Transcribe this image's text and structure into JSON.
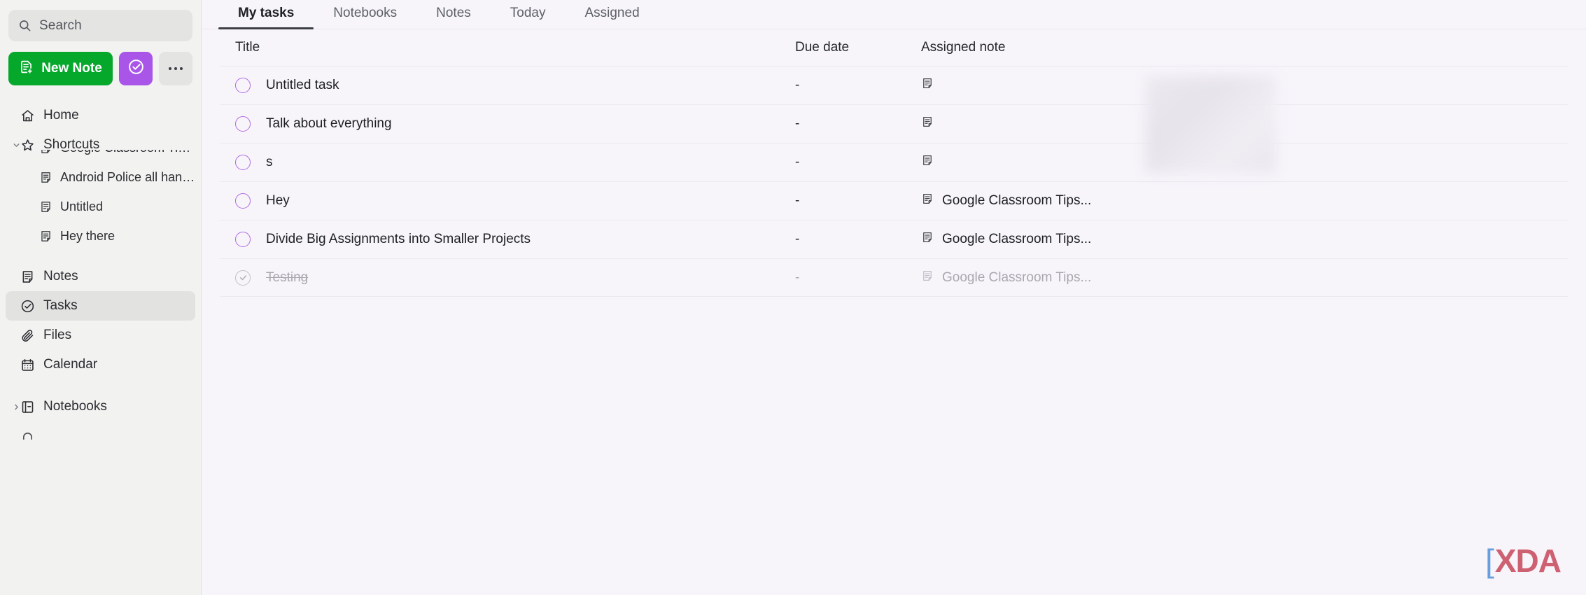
{
  "sidebar": {
    "search": {
      "placeholder": "Search",
      "icon": "search-icon"
    },
    "new_note_button": {
      "label": "New Note",
      "icon": "note-plus-icon",
      "color": "#06a82c"
    },
    "task_button": {
      "icon": "check-circle-icon",
      "color": "#a855e8"
    },
    "more_button": {
      "icon": "ellipsis-icon",
      "color": "#e4e4e3"
    },
    "nav": [
      {
        "label": "Home",
        "icon": "home-icon",
        "selected": false
      },
      {
        "label": "Shortcuts",
        "icon": "star-icon",
        "selected": false,
        "expanded": true
      }
    ],
    "shortcuts": [
      {
        "label": "Google Classroom Tips...",
        "icon": "note-icon"
      },
      {
        "label": "Android Police all hand...",
        "icon": "note-icon"
      },
      {
        "label": "Untitled",
        "icon": "note-icon"
      },
      {
        "label": "Hey there",
        "icon": "note-icon"
      }
    ],
    "sections": [
      {
        "label": "Notes",
        "icon": "note-icon",
        "selected": false
      },
      {
        "label": "Tasks",
        "icon": "check-circle-icon",
        "selected": true
      },
      {
        "label": "Files",
        "icon": "paperclip-icon",
        "selected": false
      },
      {
        "label": "Calendar",
        "icon": "calendar-icon",
        "selected": false
      }
    ],
    "notebooks": {
      "label": "Notebooks",
      "icon": "notebook-icon",
      "expanded": false
    }
  },
  "main": {
    "tabs": [
      {
        "label": "My tasks",
        "active": true
      },
      {
        "label": "Notebooks",
        "active": false
      },
      {
        "label": "Notes",
        "active": false
      },
      {
        "label": "Today",
        "active": false
      },
      {
        "label": "Assigned",
        "active": false
      }
    ],
    "columns": {
      "title": "Title",
      "due_date": "Due date",
      "assigned_note": "Assigned note"
    },
    "tasks": [
      {
        "title": "Untitled task",
        "due": "-",
        "note": "",
        "note_icon": "note-icon",
        "completed": false
      },
      {
        "title": "Talk about everything",
        "due": "-",
        "note": "",
        "note_icon": "note-icon",
        "completed": false
      },
      {
        "title": "s",
        "due": "-",
        "note": "",
        "note_icon": "note-icon",
        "completed": false
      },
      {
        "title": "Hey",
        "due": "-",
        "note": "Google Classroom Tips...",
        "note_icon": "note-icon",
        "completed": false
      },
      {
        "title": "Divide Big Assignments into Smaller Projects",
        "due": "-",
        "note": "Google Classroom Tips...",
        "note_icon": "note-icon",
        "completed": false
      },
      {
        "title": "Testing",
        "due": "-",
        "note": "Google Classroom Tips...",
        "note_icon": "note-icon",
        "completed": true
      }
    ]
  },
  "watermark": {
    "text": "XDA"
  }
}
